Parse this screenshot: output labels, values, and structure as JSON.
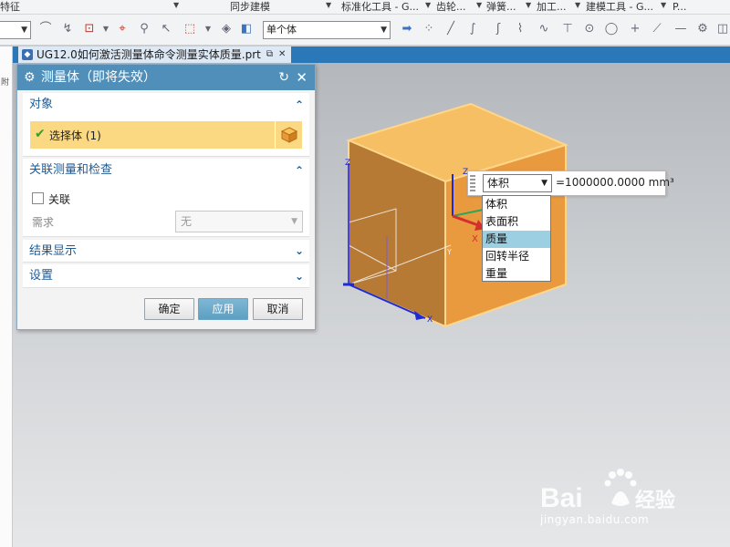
{
  "ribbon": {
    "groups": [
      "特征",
      "同步建模",
      "标准化工具 - G...",
      "齿轮...",
      "弹簧...",
      "加工...",
      "建模工具 - G...",
      "P..."
    ]
  },
  "toolbar": {
    "selection_scope": "单个体",
    "icons": [
      "fillet-icon",
      "edge-icon",
      "snap-icon",
      "cursor-select-icon",
      "filter-icon",
      "box-select-icon",
      "sketch-icon",
      "cube-icon"
    ],
    "snap_icons": [
      "arrow-right-icon",
      "point-icon",
      "line-icon",
      "curve-icon",
      "spline-icon",
      "arc-icon",
      "wave-icon",
      "intersect-icon",
      "circle-icon",
      "target-icon",
      "plus-icon",
      "tangent-icon",
      "minus-icon",
      "settings-icon",
      "layers-icon"
    ]
  },
  "left_strip": {
    "label": "附"
  },
  "document_tab": {
    "title": "UG12.0如何激活测量体命令测量实体质量.prt",
    "icons": [
      "part-file-icon",
      "float-icon",
      "close-icon"
    ]
  },
  "dialog": {
    "title": "测量体（即将失效）",
    "sections": {
      "object": {
        "label": "对象",
        "select_body": "选择体 (1)"
      },
      "associative": {
        "label": "关联测量和检查",
        "checkbox_label": "关联",
        "checked": false,
        "requirement_label": "需求",
        "requirement_value": "无"
      },
      "results_display": {
        "label": "结果显示"
      },
      "settings": {
        "label": "设置"
      }
    },
    "buttons": {
      "ok": "确定",
      "apply": "应用",
      "cancel": "取消"
    }
  },
  "measurement": {
    "selected_type": "体积",
    "value_text": "=1000000.0000 mm³",
    "options": [
      "体积",
      "表面积",
      "质量",
      "回转半径",
      "重量"
    ],
    "highlighted_option": "质量"
  },
  "viewport": {
    "axis_labels": {
      "x": "X",
      "y": "Y",
      "z": "Z"
    },
    "colors": {
      "cube_top": "#f6b95a",
      "cube_front": "#e89a40",
      "cube_side": "#b4772f",
      "cube_edge": "#ffd27a",
      "axis_blue": "#1d2bd6",
      "axis_red": "#d62d2d",
      "axis_green": "#2aa55a"
    }
  },
  "watermark": {
    "logo": "Baidu经验",
    "url": "jingyan.baidu.com"
  }
}
